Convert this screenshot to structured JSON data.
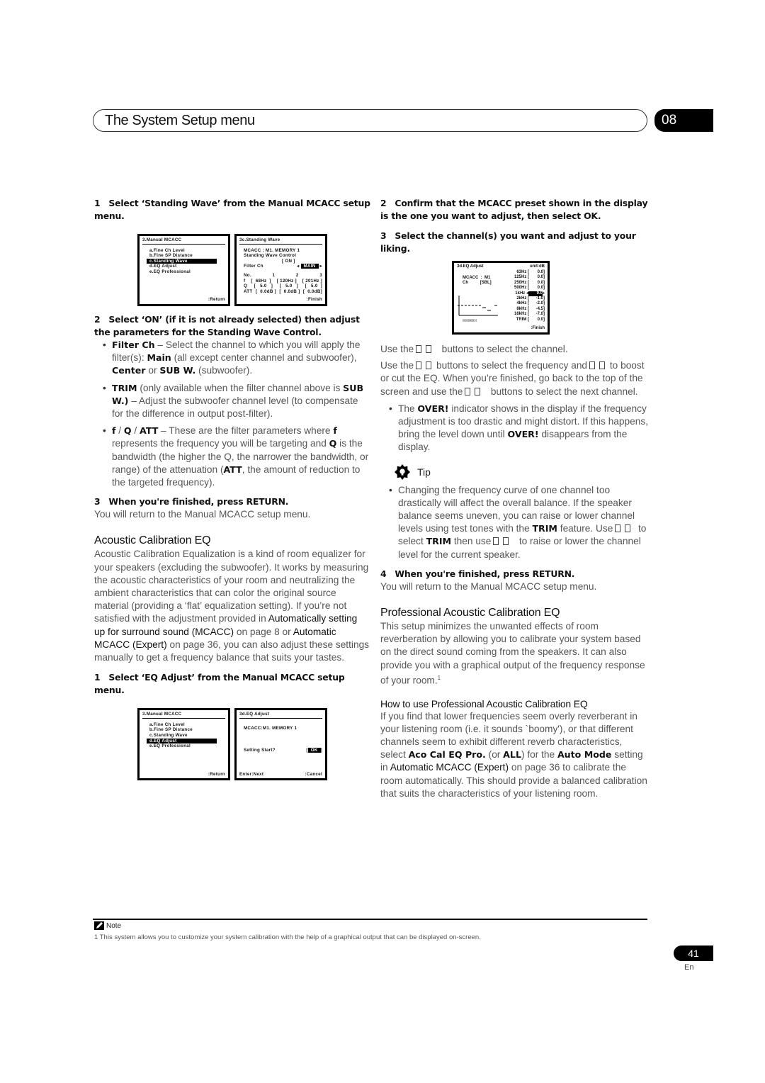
{
  "header": {
    "title": "The System Setup menu",
    "chapter": "08"
  },
  "left": {
    "s1_num": "1",
    "s1": "Select ‘Standing Wave’ from the Manual MCACC setup menu.",
    "osd_menu": {
      "title": "3.Manual  MCACC",
      "items": [
        "a.Fine  Ch  Level",
        "b.Fine  SP  Distance",
        "c.Standing  Wave",
        "d.EQ  Adjust",
        "e.EQ  Professional"
      ],
      "footer": ":Return"
    },
    "osd_sw": {
      "title": "3c.Standing  Wave",
      "line1": "MCACC  :  M1. MEMORY  1",
      "line2": "Standing  Wave  Control",
      "on_value": "[      ON    ]",
      "filter_label": "Filter  Ch",
      "filter_value": "MAIN",
      "no_row": [
        "No.",
        "1",
        "2",
        "3"
      ],
      "f_row": [
        "f",
        "[  68Hz  ]",
        "[ 120Hz ]",
        "[ 201Hz ]"
      ],
      "q_row": [
        "Q",
        "[   5.0   ]",
        "[   5.0   ]",
        "[   5.0  ]"
      ],
      "att_row": [
        "ATT",
        "[  0.0dB ]",
        "[  0.0dB ]",
        "[  0.0dB]"
      ],
      "footer": ":Finish"
    },
    "s2_num": "2",
    "s2": "Select ‘ON’ (if it is not already selected) then adjust the parameters for the Standing Wave Control.",
    "b1": {
      "t1": "Filter Ch",
      "t2": " – Select the channel to which you will apply the filter(s): ",
      "t3": "Main",
      "t4": " (all except center channel and subwoofer), ",
      "t5": "Center",
      "t6": " or ",
      "t7": "SUB W.",
      "t8": " (subwoofer)."
    },
    "b2": {
      "t1": "TRIM",
      "t2": " (only available when the filter channel above is ",
      "t3": "SUB W.)",
      "t4": " – Adjust the subwoofer channel level (to compensate for the difference in output post-filter)."
    },
    "b3": {
      "t1": "f",
      "t2": " / ",
      "t3": "Q",
      "t4": " / ",
      "t5": "ATT",
      "t6": " – These are the filter parameters where ",
      "t7": "f",
      "t8": " represents the frequency you will be targeting and ",
      "t9": "Q",
      "t10": " is the bandwidth (the higher the Q, the narrower the bandwidth, or range) of the attenuation (",
      "t11": "ATT",
      "t12": ", the amount of reduction to the targeted frequency)."
    },
    "s3_num": "3",
    "s3": "When you're finished, press RETURN.",
    "s3_body": "You will return to the Manual MCACC setup menu.",
    "h_ace": "Acoustic Calibration EQ",
    "ace_p": {
      "t1": "Acoustic Calibration Equalization is a kind of room equalizer for your speakers (excluding the subwoofer). It works by measuring the acoustic characteristics of your room and neutralizing the ambient characteristics that can color the original source material (providing a ‘flat’ equalization setting). If you’re not satisfied with the adjustment provided in ",
      "ref1": "Automatically setting up for surround sound (MCACC)",
      "t2": " on page 8 or ",
      "ref2": "Automatic MCACC (Expert)",
      "t3": " on page 36, you can also adjust these settings manually to get a frequency balance that suits your tastes."
    },
    "s4_num": "1",
    "s4": "Select ‘EQ Adjust’ from the Manual MCACC setup menu.",
    "osd_menu2": {
      "title": "3.Manual  MCACC",
      "items": [
        "a.Fine  Ch  Level",
        "b.Fine  SP  Distance",
        "c.Standing  Wave",
        "d.EQ  Adjust",
        "e.EQ  Professional"
      ],
      "footer": ":Return"
    },
    "osd_eqstart": {
      "title": "3d.EQ  Adjust",
      "line1": "MCACC:M1. MEMORY  1",
      "prompt": "Setting  Start?",
      "ok": "OK",
      "footer_left": "Enter:Next",
      "footer_right": ":Cancel"
    }
  },
  "right": {
    "s2_num": "2",
    "s2": "Confirm that the MCACC preset shown in the display is the one you want to adjust, then select OK.",
    "s3_num": "3",
    "s3": "Select the channel(s) you want and adjust to your liking.",
    "osd_eq": {
      "title": "3d.EQ  Adjust",
      "unit": "unit:dB",
      "mcacc": "MCACC  :  M1",
      "ch": "Ch          [SBL]",
      "bands": [
        {
          "freq": "63Hz",
          "value": "0.0"
        },
        {
          "freq": "125Hz",
          "value": "0.0"
        },
        {
          "freq": "250Hz",
          "value": "0.0"
        },
        {
          "freq": "500Hz",
          "value": "0.0"
        },
        {
          "freq": "1kHz",
          "value": "0.0",
          "selected": true
        },
        {
          "freq": "2kHz",
          "value": "-1.0"
        },
        {
          "freq": "4kHz",
          "value": "-2.0"
        },
        {
          "freq": "8kHz",
          "value": "-4.5"
        },
        {
          "freq": "16kHz",
          "value": "-7.0"
        },
        {
          "freq": "TRIM",
          "value": "0.0"
        }
      ],
      "footer": ":Finish"
    },
    "p1": {
      "t1": "Use the",
      "t2": "buttons to select the channel."
    },
    "p2": {
      "t1": "Use the",
      "t2": "buttons to select the frequency and",
      "t3": "to boost or cut the EQ. When you’re finished, go back to the top of the screen and use the",
      "t4": "buttons to select the next channel."
    },
    "b_over": {
      "t1": "The ",
      "t2": "OVER!",
      "t3": " indicator shows in the display if the frequency adjustment is too drastic and might distort. If this happens, bring the level down until ",
      "t4": "OVER!",
      "t5": " disappears from the display."
    },
    "tip_label": "Tip",
    "b_tip": {
      "t1": "Changing the frequency curve of one channel too drastically will affect the overall balance. If the speaker balance seems uneven, you can raise or lower channel levels using test tones with the ",
      "t2": "TRIM",
      "t3": " feature. Use",
      "t4": "to select ",
      "t5": "TRIM",
      "t6": " then use",
      "t7": "to raise or lower the channel level for the current speaker."
    },
    "s4_num": "4",
    "s4": "When you're finished, press RETURN.",
    "s4_body": "You will return to the Manual MCACC setup menu.",
    "h_pro": "Professional Acoustic Calibration EQ",
    "pro_p": "This setup minimizes the unwanted effects of room reverberation by allowing you to calibrate your system based on the direct sound coming from the speakers. It can also provide you with a graphical output of the frequency response of your room.",
    "pro_sup": "1",
    "h_how": "How to use Professional Acoustic Calibration EQ",
    "how_p": {
      "t1": "If you find that lower frequencies seem overly reverberant in your listening room (i.e. it sounds `boomy'), or that different channels seem to exhibit different reverb characteristics, select ",
      "t2": "Aco Cal EQ Pro.",
      "t3": " (or ",
      "t4": "ALL",
      "t5": ") for the ",
      "t6": "Auto Mode",
      "t7": " setting in ",
      "ref": "Automatic MCACC (Expert)",
      "t8": " on page 36 to calibrate the room automatically. This should provide a balanced calibration that suits the characteristics of your listening room."
    }
  },
  "footer": {
    "note_label": "Note",
    "footnote": "1 This system allows you to customize your system calibration with the help of a graphical output that can be displayed on-screen.",
    "page_number": "41",
    "lang": "En"
  }
}
